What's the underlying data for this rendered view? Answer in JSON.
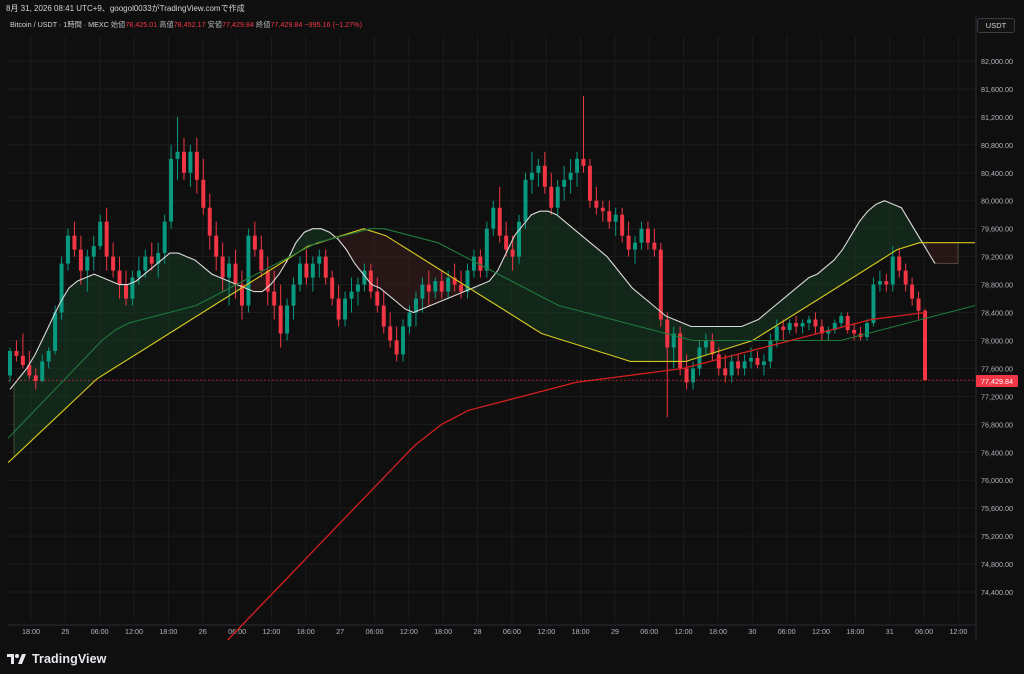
{
  "header": {
    "snapshot": "8月 31, 2026 08:41 UTC+9、googol0033がTradingView.comで作成"
  },
  "legend": {
    "symbol": "Bitcoin / USDT · 1時間 · MEXC",
    "open_label": "始値",
    "open_value": "78,425.01",
    "high_label": "高値",
    "high_value": "78,452.17",
    "low_label": "安値",
    "low_value": "77,429.84",
    "close_label": "終値",
    "close_value": "77,429.84",
    "change": "−995.16 (−1.27%)"
  },
  "toolbar": {
    "currency_label": "USDT"
  },
  "price_tag": "77,429.84",
  "footer": {
    "brand": "TradingView"
  },
  "colors": {
    "background": "#0f0f0f",
    "grid": "#1c1c1c",
    "up": "#089981",
    "down": "#f23645",
    "ma_white": "#d9d9d9",
    "ma_yellow": "#d4c81e",
    "ma_green": "#1e7b3c",
    "ma_red": "#d61f1f",
    "cloud_bull": "#183a24",
    "cloud_bear": "#3a1d1d"
  },
  "chart_data": {
    "type": "candlestick",
    "y_axis_ticks": [
      "82,000.00",
      "81,600.00",
      "81,200.00",
      "80,800.00",
      "80,400.00",
      "80,000.00",
      "79,600.00",
      "79,200.00",
      "78,800.00",
      "78,400.00",
      "78,000.00",
      "77,600.00",
      "77,200.00",
      "76,800.00",
      "76,400.00",
      "76,000.00",
      "75,600.00",
      "75,200.00",
      "74,800.00",
      "74,400.00"
    ],
    "x_axis_ticks": [
      "18:00",
      "25",
      "06:00",
      "12:00",
      "18:00",
      "26",
      "06:00",
      "12:00",
      "18:00",
      "27",
      "06:00",
      "12:00",
      "18:00",
      "28",
      "06:00",
      "12:00",
      "18:00",
      "29",
      "06:00",
      "12:00",
      "18:00",
      "30",
      "06:00",
      "12:00",
      "18:00",
      "31",
      "06:00",
      "12:00"
    ],
    "ylim": [
      74000,
      82300
    ],
    "last_price": 77429.84,
    "candles": [
      [
        77500,
        77900,
        77400,
        77850
      ],
      [
        77850,
        78000,
        77700,
        77780
      ],
      [
        77780,
        78100,
        77600,
        77650
      ],
      [
        77650,
        77850,
        77450,
        77500
      ],
      [
        77500,
        77600,
        77300,
        77420
      ],
      [
        77420,
        77800,
        77400,
        77700
      ],
      [
        77700,
        77900,
        77600,
        77850
      ],
      [
        77850,
        78500,
        77800,
        78400
      ],
      [
        78400,
        79200,
        78300,
        79100
      ],
      [
        79100,
        79600,
        79000,
        79500
      ],
      [
        79500,
        79700,
        79200,
        79300
      ],
      [
        79300,
        79500,
        78800,
        79000
      ],
      [
        79000,
        79300,
        78700,
        79200
      ],
      [
        79200,
        79500,
        79000,
        79350
      ],
      [
        79350,
        79800,
        79300,
        79700
      ],
      [
        79700,
        79900,
        79000,
        79200
      ],
      [
        79200,
        79400,
        78900,
        79000
      ],
      [
        79000,
        79200,
        78600,
        78800
      ],
      [
        78800,
        79000,
        78500,
        78600
      ],
      [
        78600,
        79000,
        78500,
        78900
      ],
      [
        78900,
        79200,
        78800,
        79000
      ],
      [
        79000,
        79300,
        78900,
        79200
      ],
      [
        79200,
        79400,
        79000,
        79100
      ],
      [
        79100,
        79400,
        78900,
        79250
      ],
      [
        79250,
        79800,
        79100,
        79700
      ],
      [
        79700,
        80800,
        79600,
        80600
      ],
      [
        80600,
        81200,
        80300,
        80700
      ],
      [
        80700,
        80900,
        80300,
        80400
      ],
      [
        80400,
        80800,
        80200,
        80700
      ],
      [
        80700,
        80900,
        80100,
        80300
      ],
      [
        80300,
        80600,
        79800,
        79900
      ],
      [
        79900,
        80100,
        79300,
        79500
      ],
      [
        79500,
        79700,
        79000,
        79200
      ],
      [
        79200,
        79400,
        78700,
        78900
      ],
      [
        78900,
        79200,
        78500,
        79100
      ],
      [
        79100,
        79300,
        78600,
        78800
      ],
      [
        78800,
        79000,
        78300,
        78500
      ],
      [
        78500,
        79600,
        78400,
        79500
      ],
      [
        79500,
        79700,
        79200,
        79300
      ],
      [
        79300,
        79500,
        78900,
        79000
      ],
      [
        79000,
        79200,
        78500,
        78700
      ],
      [
        78700,
        79000,
        78300,
        78500
      ],
      [
        78500,
        78800,
        77900,
        78100
      ],
      [
        78100,
        78600,
        78000,
        78500
      ],
      [
        78500,
        78900,
        78300,
        78800
      ],
      [
        78800,
        79200,
        78700,
        79100
      ],
      [
        79100,
        79300,
        78800,
        78900
      ],
      [
        78900,
        79200,
        78700,
        79100
      ],
      [
        79100,
        79300,
        78900,
        79200
      ],
      [
        79200,
        79300,
        78800,
        78900
      ],
      [
        78900,
        79000,
        78500,
        78600
      ],
      [
        78600,
        78800,
        78200,
        78300
      ],
      [
        78300,
        78700,
        78200,
        78600
      ],
      [
        78600,
        78900,
        78400,
        78700
      ],
      [
        78700,
        78900,
        78500,
        78800
      ],
      [
        78800,
        79100,
        78700,
        79000
      ],
      [
        79000,
        79100,
        78600,
        78700
      ],
      [
        78700,
        78900,
        78400,
        78500
      ],
      [
        78500,
        78700,
        78100,
        78200
      ],
      [
        78200,
        78400,
        77900,
        78000
      ],
      [
        78000,
        78200,
        77700,
        77800
      ],
      [
        77800,
        78300,
        77700,
        78200
      ],
      [
        78200,
        78500,
        78100,
        78400
      ],
      [
        78400,
        78700,
        78200,
        78600
      ],
      [
        78600,
        78900,
        78400,
        78800
      ],
      [
        78800,
        79000,
        78500,
        78700
      ],
      [
        78700,
        78900,
        78600,
        78850
      ],
      [
        78850,
        79000,
        78600,
        78700
      ],
      [
        78700,
        79000,
        78600,
        78900
      ],
      [
        78900,
        79100,
        78700,
        78800
      ],
      [
        78800,
        79000,
        78600,
        78700
      ],
      [
        78700,
        79100,
        78600,
        79000
      ],
      [
        79000,
        79300,
        78900,
        79200
      ],
      [
        79200,
        79300,
        78900,
        79000
      ],
      [
        79000,
        79700,
        78900,
        79600
      ],
      [
        79600,
        80000,
        79500,
        79900
      ],
      [
        79900,
        80200,
        79400,
        79500
      ],
      [
        79500,
        79700,
        79200,
        79300
      ],
      [
        79300,
        79500,
        79000,
        79200
      ],
      [
        79200,
        79800,
        79100,
        79700
      ],
      [
        79700,
        80400,
        79600,
        80300
      ],
      [
        80300,
        80700,
        80100,
        80400
      ],
      [
        80400,
        80600,
        80200,
        80500
      ],
      [
        80500,
        80700,
        80100,
        80200
      ],
      [
        80200,
        80400,
        79800,
        79900
      ],
      [
        79900,
        80300,
        79800,
        80200
      ],
      [
        80200,
        80500,
        80000,
        80300
      ],
      [
        80300,
        80600,
        80100,
        80400
      ],
      [
        80400,
        80700,
        80200,
        80600
      ],
      [
        80600,
        81500,
        80400,
        80500
      ],
      [
        80500,
        80600,
        79900,
        80000
      ],
      [
        80000,
        80200,
        79800,
        79900
      ],
      [
        79900,
        80000,
        79700,
        79850
      ],
      [
        79850,
        80000,
        79600,
        79700
      ],
      [
        79700,
        79900,
        79500,
        79800
      ],
      [
        79800,
        79900,
        79400,
        79500
      ],
      [
        79500,
        79700,
        79200,
        79300
      ],
      [
        79300,
        79500,
        79100,
        79400
      ],
      [
        79400,
        79700,
        79300,
        79600
      ],
      [
        79600,
        79700,
        79300,
        79400
      ],
      [
        79400,
        79600,
        79200,
        79300
      ],
      [
        79300,
        79400,
        78200,
        78300
      ],
      [
        78300,
        78400,
        76900,
        77900
      ],
      [
        77900,
        78200,
        77600,
        78100
      ],
      [
        78100,
        78200,
        77500,
        77600
      ],
      [
        77600,
        77800,
        77300,
        77400
      ],
      [
        77400,
        77700,
        77300,
        77600
      ],
      [
        77600,
        78000,
        77500,
        77900
      ],
      [
        77900,
        78100,
        77800,
        78000
      ],
      [
        78000,
        78100,
        77700,
        77800
      ],
      [
        77800,
        77900,
        77500,
        77600
      ],
      [
        77600,
        77800,
        77400,
        77500
      ],
      [
        77500,
        77800,
        77400,
        77700
      ],
      [
        77700,
        77800,
        77500,
        77600
      ],
      [
        77600,
        77800,
        77500,
        77700
      ],
      [
        77700,
        77900,
        77600,
        77750
      ],
      [
        77750,
        77850,
        77600,
        77650
      ],
      [
        77650,
        77800,
        77500,
        77700
      ],
      [
        77700,
        78100,
        77600,
        78000
      ],
      [
        78000,
        78300,
        77900,
        78200
      ],
      [
        78200,
        78300,
        78000,
        78150
      ],
      [
        78150,
        78300,
        78100,
        78250
      ],
      [
        78250,
        78350,
        78100,
        78200
      ],
      [
        78200,
        78300,
        78100,
        78250
      ],
      [
        78250,
        78350,
        78150,
        78300
      ],
      [
        78300,
        78400,
        78100,
        78200
      ],
      [
        78200,
        78300,
        78000,
        78100
      ],
      [
        78100,
        78200,
        78000,
        78150
      ],
      [
        78150,
        78300,
        78100,
        78250
      ],
      [
        78250,
        78400,
        78200,
        78350
      ],
      [
        78350,
        78400,
        78100,
        78150
      ],
      [
        78150,
        78250,
        78000,
        78100
      ],
      [
        78100,
        78200,
        78000,
        78050
      ],
      [
        78050,
        78300,
        78000,
        78250
      ],
      [
        78250,
        78900,
        78200,
        78800
      ],
      [
        78800,
        79000,
        78700,
        78850
      ],
      [
        78850,
        78950,
        78700,
        78800
      ],
      [
        78800,
        79350,
        78700,
        79200
      ],
      [
        79200,
        79300,
        78900,
        79000
      ],
      [
        79000,
        79100,
        78700,
        78800
      ],
      [
        78800,
        78900,
        78500,
        78600
      ],
      [
        78600,
        78700,
        78300,
        78425
      ],
      [
        78425,
        78452,
        77430,
        77430
      ]
    ],
    "series": [
      {
        "name": "",
        "color": "#d9d9d9",
        "values": [
          77300,
          77450,
          77600,
          77800,
          78050,
          78300,
          78550,
          78750,
          78850,
          78900,
          78950,
          78900,
          78850,
          78800,
          78800,
          78850,
          78950,
          79050,
          79150,
          79250,
          79250,
          79200,
          79150,
          79050,
          78950,
          78900,
          78850,
          78800,
          78750,
          78700,
          78700,
          78800,
          78950,
          79150,
          79400,
          79550,
          79600,
          79600,
          79550,
          79450,
          79300,
          79100,
          78950,
          78800,
          78750,
          78650,
          78550,
          78450,
          78400,
          78450,
          78500,
          78550,
          78600,
          78650,
          78700,
          78750,
          78800,
          78850,
          79000,
          79250,
          79500,
          79650,
          79800,
          79850,
          79850,
          79800,
          79700,
          79600,
          79500,
          79400,
          79300,
          79200,
          79050,
          78900,
          78750,
          78650,
          78550,
          78450,
          78350,
          78300,
          78250,
          78200,
          78200,
          78200,
          78200,
          78200,
          78200,
          78200,
          78250,
          78300,
          78400,
          78500,
          78600,
          78700,
          78800,
          78900,
          78950,
          79050,
          79150,
          79300,
          79500,
          79700,
          79850,
          79950,
          80000,
          79950,
          79900,
          79700,
          79500,
          79300,
          79100
        ]
      },
      {
        "name": "",
        "color": "#d4c81e",
        "values": [
          76250,
          76400,
          76550,
          76700,
          76850,
          77000,
          77150,
          77300,
          77450,
          77550,
          77650,
          77750,
          77850,
          77950,
          78050,
          78150,
          78250,
          78350,
          78450,
          78550,
          78650,
          78750,
          78850,
          78950,
          79050,
          79150,
          79250,
          79350,
          79400,
          79450,
          79500,
          79550,
          79600,
          79550,
          79500,
          79400,
          79300,
          79200,
          79100,
          79000,
          78900,
          78800,
          78700,
          78600,
          78500,
          78400,
          78300,
          78200,
          78100,
          78050,
          78000,
          77950,
          77900,
          77850,
          77800,
          77750,
          77700,
          77700,
          77700,
          77700,
          77700,
          77700,
          77750,
          77800,
          77850,
          77900,
          77950,
          78000,
          78100,
          78200,
          78300,
          78400,
          78500,
          78600,
          78700,
          78800,
          78900,
          79000,
          79100,
          79200,
          79300,
          79350,
          79400,
          79400,
          79400,
          79400,
          79400,
          79400
        ]
      },
      {
        "name": "",
        "color": "#1e7b3c",
        "values": [
          76600,
          76800,
          77000,
          77200,
          77400,
          77600,
          77800,
          78000,
          78150,
          78250,
          78300,
          78350,
          78400,
          78450,
          78500,
          78600,
          78700,
          78800,
          78900,
          79000,
          79100,
          79200,
          79300,
          79400,
          79450,
          79500,
          79550,
          79600,
          79600,
          79550,
          79500,
          79450,
          79400,
          79300,
          79200,
          79100,
          79000,
          78900,
          78800,
          78700,
          78600,
          78500,
          78450,
          78400,
          78350,
          78300,
          78250,
          78200,
          78150,
          78100,
          78050,
          78000,
          78000,
          78000,
          78000,
          78000,
          78000,
          78000,
          78000,
          78000,
          78000,
          78000,
          78000,
          78050,
          78100,
          78150,
          78200,
          78250,
          78300,
          78350,
          78400,
          78450,
          78500
        ]
      },
      {
        "name": "",
        "color": "#d61f1f",
        "values": [
          73300,
          73700,
          74100,
          74500,
          74900,
          75300,
          75700,
          76100,
          76500,
          76800,
          77000,
          77100,
          77200,
          77300,
          77400,
          77450,
          77500,
          77550,
          77600,
          77700,
          77800,
          77900,
          78000,
          78100,
          78200,
          78300,
          78350,
          78400
        ]
      }
    ]
  }
}
